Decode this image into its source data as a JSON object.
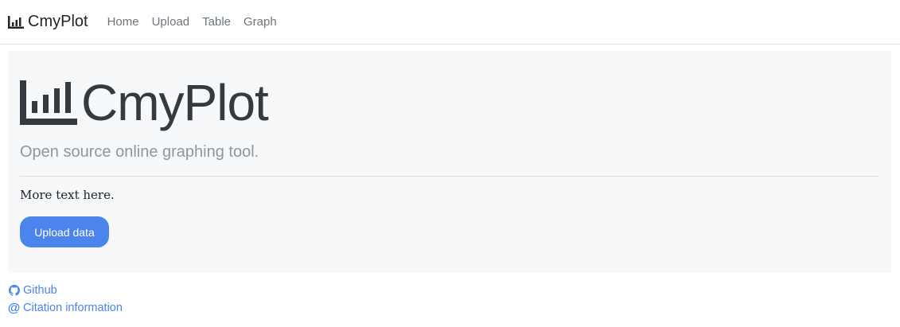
{
  "navbar": {
    "brand": "CmyPlot",
    "brand_icon": "bar-chart-icon",
    "links": [
      "Home",
      "Upload",
      "Table",
      "Graph"
    ]
  },
  "hero": {
    "title": "CmyPlot",
    "title_icon": "bar-chart-icon",
    "lead": "Open source online graphing tool.",
    "text": "More text here.",
    "button_label": "Upload data"
  },
  "footer": {
    "links": [
      {
        "label": "Github",
        "icon": "github-icon"
      },
      {
        "label": "Citation information",
        "icon": "at-icon"
      }
    ]
  },
  "colors": {
    "accent": "#4a84ec",
    "jumbotron_bg": "#f7f8f9",
    "muted_text": "#8f969c"
  }
}
